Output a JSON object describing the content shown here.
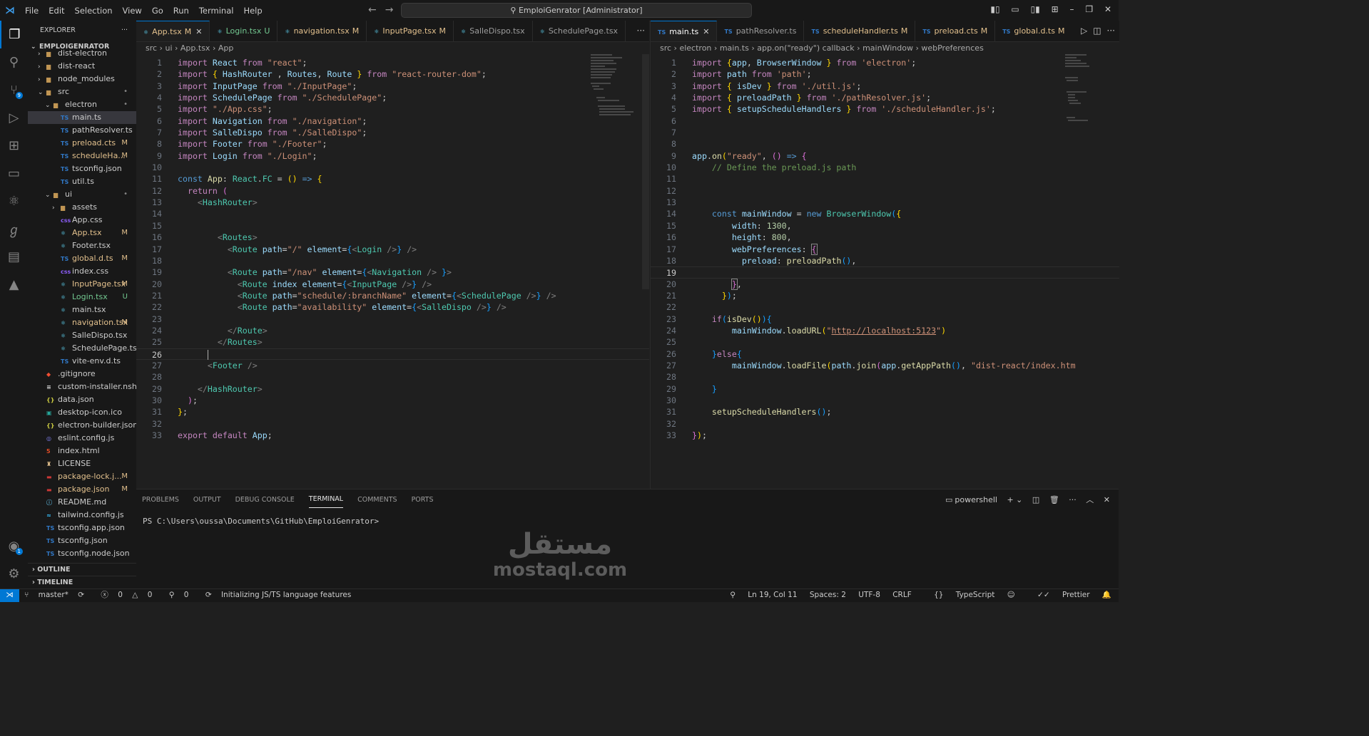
{
  "titlebar": {
    "menu": [
      "File",
      "Edit",
      "Selection",
      "View",
      "Go",
      "Run",
      "Terminal",
      "Help"
    ],
    "search": "EmploiGenrator [Administrator]",
    "search_icon": "search-icon"
  },
  "activity": [
    "explorer-icon",
    "search-icon",
    "source-control-icon",
    "run-debug-icon",
    "extensions-icon",
    "remote-explorer-icon",
    "react-icon",
    "git-graph-icon",
    "docker-icon",
    "angular-icon"
  ],
  "activity_badge": "9",
  "account_badge": "1",
  "explorer": {
    "title": "EXPLORER",
    "root": "EMPLOIGENRATOR",
    "items": [
      {
        "name": "dist-electron",
        "icon": "folder",
        "depth": 1,
        "arrow": "›",
        "status": ""
      },
      {
        "name": "dist-react",
        "icon": "folder",
        "depth": 1,
        "arrow": "›",
        "status": ""
      },
      {
        "name": "node_modules",
        "icon": "folder",
        "depth": 1,
        "arrow": "›",
        "status": ""
      },
      {
        "name": "src",
        "icon": "folder-open",
        "depth": 1,
        "arrow": "⌄",
        "status": "•"
      },
      {
        "name": "electron",
        "icon": "folder-open",
        "depth": 2,
        "arrow": "⌄",
        "status": "•"
      },
      {
        "name": "main.ts",
        "icon": "TS",
        "depth": 3,
        "arrow": "",
        "status": ""
      },
      {
        "name": "pathResolver.ts",
        "icon": "TS",
        "depth": 3,
        "arrow": "",
        "status": ""
      },
      {
        "name": "preload.cts",
        "icon": "TS",
        "depth": 3,
        "arrow": "",
        "status": "M"
      },
      {
        "name": "scheduleHa...",
        "icon": "TS",
        "depth": 3,
        "arrow": "",
        "status": "M"
      },
      {
        "name": "tsconfig.json",
        "icon": "TS",
        "depth": 3,
        "arrow": "",
        "status": ""
      },
      {
        "name": "util.ts",
        "icon": "TS",
        "depth": 3,
        "arrow": "",
        "status": ""
      },
      {
        "name": "ui",
        "icon": "folder-open",
        "depth": 2,
        "arrow": "⌄",
        "status": "•"
      },
      {
        "name": "assets",
        "icon": "folder",
        "depth": 3,
        "arrow": "›",
        "status": ""
      },
      {
        "name": "App.css",
        "icon": "css",
        "depth": 3,
        "arrow": "",
        "status": ""
      },
      {
        "name": "App.tsx",
        "icon": "tsx",
        "depth": 3,
        "arrow": "",
        "status": "M"
      },
      {
        "name": "Footer.tsx",
        "icon": "tsx",
        "depth": 3,
        "arrow": "",
        "status": ""
      },
      {
        "name": "global.d.ts",
        "icon": "TS",
        "depth": 3,
        "arrow": "",
        "status": "M"
      },
      {
        "name": "index.css",
        "icon": "css",
        "depth": 3,
        "arrow": "",
        "status": ""
      },
      {
        "name": "InputPage.tsx",
        "icon": "tsx",
        "depth": 3,
        "arrow": "",
        "status": "M"
      },
      {
        "name": "Login.tsx",
        "icon": "tsx",
        "depth": 3,
        "arrow": "",
        "status": "U"
      },
      {
        "name": "main.tsx",
        "icon": "tsx",
        "depth": 3,
        "arrow": "",
        "status": ""
      },
      {
        "name": "navigation.tsx",
        "icon": "tsx",
        "depth": 3,
        "arrow": "",
        "status": "M"
      },
      {
        "name": "SalleDispo.tsx",
        "icon": "tsx",
        "depth": 3,
        "arrow": "",
        "status": ""
      },
      {
        "name": "SchedulePage.tsx",
        "icon": "tsx",
        "depth": 3,
        "arrow": "",
        "status": ""
      },
      {
        "name": "vite-env.d.ts",
        "icon": "TS",
        "depth": 3,
        "arrow": "",
        "status": ""
      },
      {
        "name": ".gitignore",
        "icon": "git",
        "depth": 1,
        "arrow": "",
        "status": ""
      },
      {
        "name": "custom-installer.nsh",
        "icon": "file",
        "depth": 1,
        "arrow": "",
        "status": ""
      },
      {
        "name": "data.json",
        "icon": "json",
        "depth": 1,
        "arrow": "",
        "status": ""
      },
      {
        "name": "desktop-icon.ico",
        "icon": "image",
        "depth": 1,
        "arrow": "",
        "status": ""
      },
      {
        "name": "electron-builder.json",
        "icon": "json",
        "depth": 1,
        "arrow": "",
        "status": ""
      },
      {
        "name": "eslint.config.js",
        "icon": "eslint",
        "depth": 1,
        "arrow": "",
        "status": ""
      },
      {
        "name": "index.html",
        "icon": "html",
        "depth": 1,
        "arrow": "",
        "status": ""
      },
      {
        "name": "LICENSE",
        "icon": "license",
        "depth": 1,
        "arrow": "",
        "status": ""
      },
      {
        "name": "package-lock.j...",
        "icon": "npm",
        "depth": 1,
        "arrow": "",
        "status": "M"
      },
      {
        "name": "package.json",
        "icon": "npm",
        "depth": 1,
        "arrow": "",
        "status": "M"
      },
      {
        "name": "README.md",
        "icon": "info",
        "depth": 1,
        "arrow": "",
        "status": ""
      },
      {
        "name": "tailwind.config.js",
        "icon": "tailwind",
        "depth": 1,
        "arrow": "",
        "status": ""
      },
      {
        "name": "tsconfig.app.json",
        "icon": "TS",
        "depth": 1,
        "arrow": "",
        "status": ""
      },
      {
        "name": "tsconfig.json",
        "icon": "TS",
        "depth": 1,
        "arrow": "",
        "status": ""
      },
      {
        "name": "tsconfig.node.json",
        "icon": "TS",
        "depth": 1,
        "arrow": "",
        "status": ""
      }
    ],
    "selected": "main.ts",
    "outline": "OUTLINE",
    "timeline": "TIMELINE"
  },
  "left_editor": {
    "tabs": [
      {
        "label": "App.tsx",
        "status": "M",
        "icon": "react-icon",
        "active": true
      },
      {
        "label": "Login.tsx",
        "status": "U",
        "icon": "react-icon",
        "active": false
      },
      {
        "label": "navigation.tsx",
        "status": "M",
        "icon": "react-icon",
        "active": false
      },
      {
        "label": "InputPage.tsx",
        "status": "M",
        "icon": "react-icon",
        "active": false
      },
      {
        "label": "SalleDispo.tsx",
        "status": "",
        "icon": "react-icon",
        "active": false
      },
      {
        "label": "SchedulePage.tsx",
        "status": "",
        "icon": "react-icon",
        "active": false
      }
    ],
    "breadcrumb": [
      "src",
      "ui",
      "App.tsx",
      "App"
    ],
    "current_line": 26
  },
  "right_editor": {
    "tabs": [
      {
        "label": "main.ts",
        "status": "",
        "icon": "TS",
        "active": true
      },
      {
        "label": "pathResolver.ts",
        "status": "",
        "icon": "TS",
        "active": false
      },
      {
        "label": "scheduleHandler.ts",
        "status": "M",
        "icon": "TS",
        "active": false
      },
      {
        "label": "preload.cts",
        "status": "M",
        "icon": "TS",
        "active": false
      },
      {
        "label": "global.d.ts",
        "status": "M",
        "icon": "TS",
        "active": false
      }
    ],
    "breadcrumb": [
      "src",
      "electron",
      "main.ts",
      "app.on(\"ready\") callback",
      "mainWindow",
      "webPreferences"
    ],
    "current_line": 19
  },
  "panel": {
    "tabs": [
      "PROBLEMS",
      "OUTPUT",
      "DEBUG CONSOLE",
      "TERMINAL",
      "COMMENTS",
      "PORTS"
    ],
    "active": "TERMINAL",
    "shell": "powershell",
    "prompt": "PS C:\\Users\\oussa\\Documents\\GitHub\\EmploiGenrator>"
  },
  "watermark": {
    "arabic": "مستقل",
    "latin": "mostaql.com"
  },
  "statusbar": {
    "branch": "master*",
    "errors": "0",
    "warnings": "0",
    "ports": "0",
    "message": "Initializing JS/TS language features",
    "position": "Ln 19, Col 11",
    "spaces": "Spaces: 2",
    "encoding": "UTF-8",
    "eol": "CRLF",
    "language": "TypeScript",
    "formatter": "Prettier"
  }
}
